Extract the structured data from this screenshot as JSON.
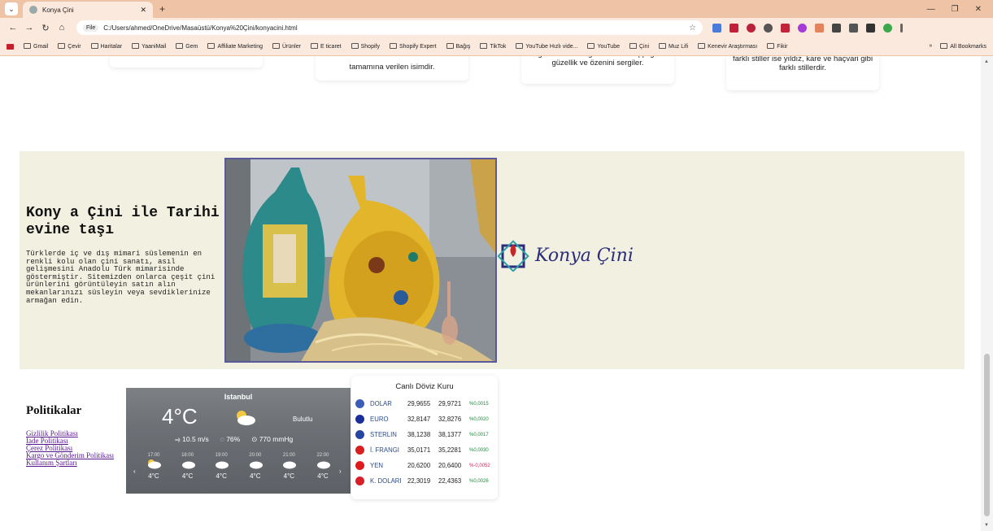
{
  "browser": {
    "tab_title": "Konya Çini",
    "new_tab_label": "+",
    "address_chip": "File",
    "address": "C:/Users/ahmed/OneDrive/Masaüstü/Konya%20Çini/konyacini.html",
    "bookmarks": [
      "Gmail",
      "Çevir",
      "Haritalar",
      "YaaniMail",
      "Gem",
      "Affiliate Marketing",
      "Ürünler",
      "E ticaret",
      "Shopify",
      "Shopify Expert",
      "Bağış",
      "TikTok",
      "YouTube Hızlı vide...",
      "YouTube",
      "Çini",
      "Muz Lifi",
      "Kenevir Araştırması",
      "Fikir"
    ],
    "all_bookmarks": "All Bookmarks"
  },
  "cards": [
    {
      "text": ""
    },
    {
      "text": "tamamına verilen isimdir."
    },
    {
      "text": "değerlendirilir ve geleneksel el işçiliğinin güzellik ve özenini sergiler."
    },
    {
      "text": "farklı stiller ise yıldız, kare ve haçvari gibi farklı stillerdir."
    }
  ],
  "hero": {
    "title": "Kony a Çini ile Tarihi evine taşı",
    "body": "Türklerde iç ve dış mimari süslemenin en renkli kolu olan çini sanatı, asıl gelişmesini Anadolu Türk mimarisinde göstermiştir. Sitemizden onlarca çeşit çini ürünlerini görüntüleyin satın alın mekanlarınızı süsleyin veya sevdiklerinize armağan edin.",
    "logo_text": "Konya Çini"
  },
  "policies": {
    "title": "Politikalar",
    "links": [
      "Gizlilik Politikası",
      "İade Politikası",
      "Çerez Politikası",
      "Kargo ve Gönderim Politikası",
      "Kullanım Şartları"
    ]
  },
  "weather": {
    "city": "Istanbul",
    "temp": "4°C",
    "condition": "Bulutlu",
    "wind": "10.5 m/s",
    "humidity": "76%",
    "pressure": "770 mmHg",
    "hours": [
      {
        "time": "17:00",
        "temp": "4°C"
      },
      {
        "time": "18:00",
        "temp": "4°C"
      },
      {
        "time": "19:00",
        "temp": "4°C"
      },
      {
        "time": "20:00",
        "temp": "4°C"
      },
      {
        "time": "21:00",
        "temp": "4°C"
      },
      {
        "time": "22:00",
        "temp": "4°C"
      }
    ]
  },
  "fx": {
    "title": "Canlı Döviz Kuru",
    "rows": [
      {
        "name": "DOLAR",
        "buy": "29,9655",
        "sell": "29,9721",
        "change": "%0,0015",
        "flag_color": "#3c5cb8",
        "change_color": "#1a8a3a"
      },
      {
        "name": "EURO",
        "buy": "32,8147",
        "sell": "32,8276",
        "change": "%0,0020",
        "flag_color": "#1b2f9a",
        "change_color": "#1a8a3a"
      },
      {
        "name": "STERLIN",
        "buy": "38,1238",
        "sell": "38,1377",
        "change": "%0,0017",
        "flag_color": "#2546a0",
        "change_color": "#1a8a3a"
      },
      {
        "name": "İ. FRANGI",
        "buy": "35,0171",
        "sell": "35,2281",
        "change": "%0,0030",
        "flag_color": "#d81e1e",
        "change_color": "#1a8a3a"
      },
      {
        "name": "YEN",
        "buy": "20,6200",
        "sell": "20,6400",
        "change": "%-0,0052",
        "flag_color": "#e01a1a",
        "change_color": "#d0245c"
      },
      {
        "name": "K. DOLARI",
        "buy": "22,3019",
        "sell": "22,4363",
        "change": "%0,0026",
        "flag_color": "#d8202a",
        "change_color": "#1a8a3a"
      }
    ]
  }
}
